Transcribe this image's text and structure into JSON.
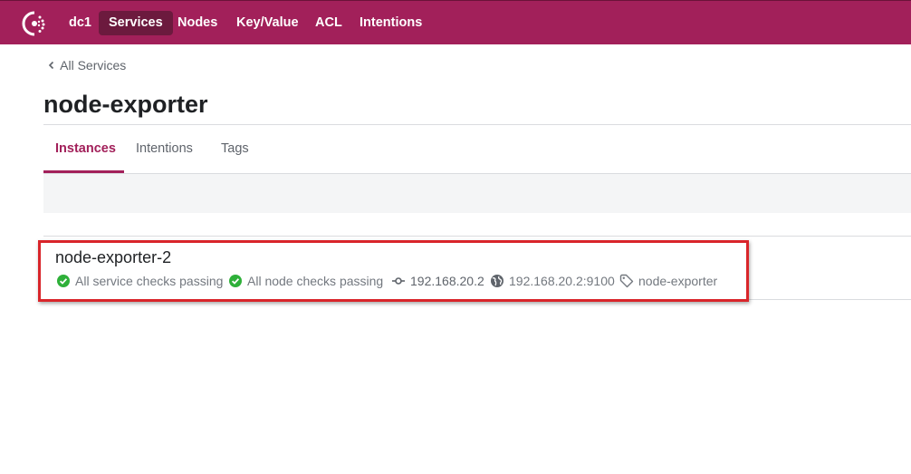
{
  "nav": {
    "datacenter": "dc1",
    "items": [
      {
        "label": "Services"
      },
      {
        "label": "Nodes"
      },
      {
        "label": "Key/Value"
      },
      {
        "label": "ACL"
      },
      {
        "label": "Intentions"
      }
    ]
  },
  "breadcrumb": {
    "label": "All Services"
  },
  "page": {
    "title": "node-exporter"
  },
  "tabs": [
    {
      "label": "Instances",
      "active": true
    },
    {
      "label": "Intentions"
    },
    {
      "label": "Tags"
    }
  ],
  "instance": {
    "name": "node-exporter-2",
    "service_checks": "All service checks passing",
    "node_checks": "All node checks passing",
    "node_address": "192.168.20.2",
    "service_address": "192.168.20.2:9100",
    "tag": "node-exporter"
  },
  "colors": {
    "brand": "#a2205a",
    "nav_active": "#6c1a3e",
    "passing": "#2eb039",
    "highlight": "#d9252a"
  },
  "icons": {
    "logo": "consul-logo",
    "back": "chevron-left-icon",
    "service_checks": "check-circle-icon",
    "node_checks": "check-circle-icon",
    "node_address": "git-commit-icon",
    "service_address": "globe-icon",
    "tag": "tag-icon"
  }
}
